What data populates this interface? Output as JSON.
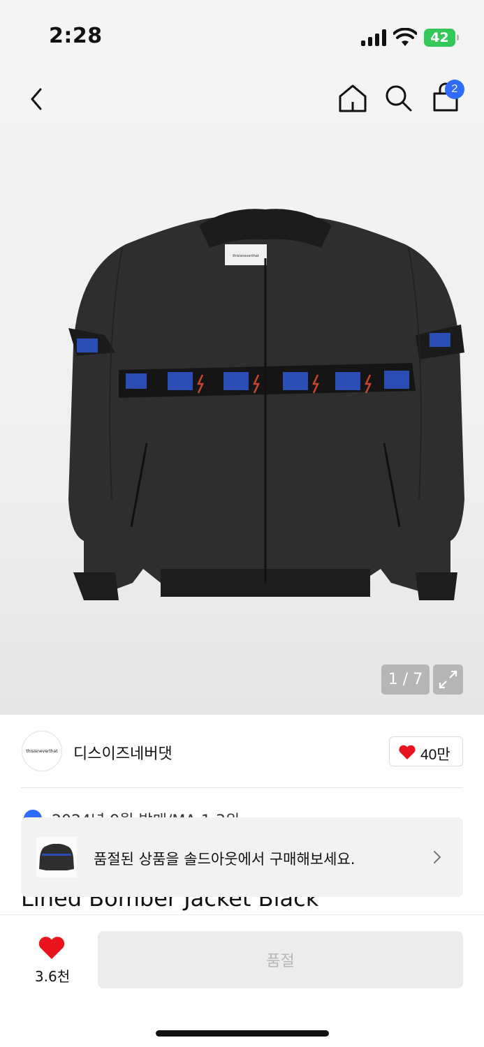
{
  "status_bar": {
    "time": "2:28",
    "battery": "42"
  },
  "header": {
    "cart_count": "2"
  },
  "gallery": {
    "counter": "1 / 7",
    "jacket_logo_text": "thisisneverthat"
  },
  "brand": {
    "logo_text": "thisisneverthat",
    "name": "디스이즈네버댓",
    "likes": "40만"
  },
  "info_peek": {
    "text": "2024년 9월 발매/MA-1 3위"
  },
  "title_peek": {
    "text": "Lined Bomber Jacket Black"
  },
  "banner": {
    "text": "품절된 상품을 솔드아웃에서 구매해보세요."
  },
  "bottom_bar": {
    "wish_count": "3.6천",
    "buy_label": "품절"
  },
  "colors": {
    "accent": "#2f6bff",
    "heart": "#e8141e",
    "battery": "#34c759"
  }
}
